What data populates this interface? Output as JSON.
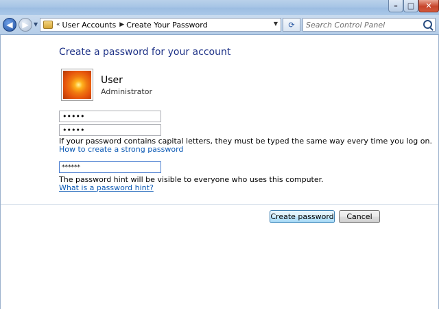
{
  "window": {
    "caption_buttons": {
      "minimize": "–",
      "maximize": "□",
      "close": "✕"
    }
  },
  "nav": {
    "back_glyph": "◀",
    "forward_glyph": "▶",
    "recent_glyph": "▼",
    "breadcrumb_prefix": "«",
    "breadcrumbs": [
      "User Accounts",
      "Create Your Password"
    ],
    "breadcrumb_separator": "▶",
    "address_dropdown": "▼",
    "refresh_glyph": "⟳",
    "search_placeholder": "Search Control Panel"
  },
  "main": {
    "title": "Create a password for your account",
    "user": {
      "name": "User",
      "role": "Administrator"
    },
    "password_value": "•••••",
    "confirm_value": "•••••",
    "password_note": "If your password contains capital letters, they must be typed the same way every time you log on.",
    "strong_password_link": "How to create a strong password",
    "hint_value": "******",
    "hint_note": "The password hint will be visible to everyone who uses this computer.",
    "hint_link": "What is a password hint?"
  },
  "actions": {
    "create_label": "Create password",
    "cancel_label": "Cancel"
  },
  "colors": {
    "title": "#1e3287",
    "link": "#0a58b4",
    "nav_bar": "#b5cde8"
  }
}
